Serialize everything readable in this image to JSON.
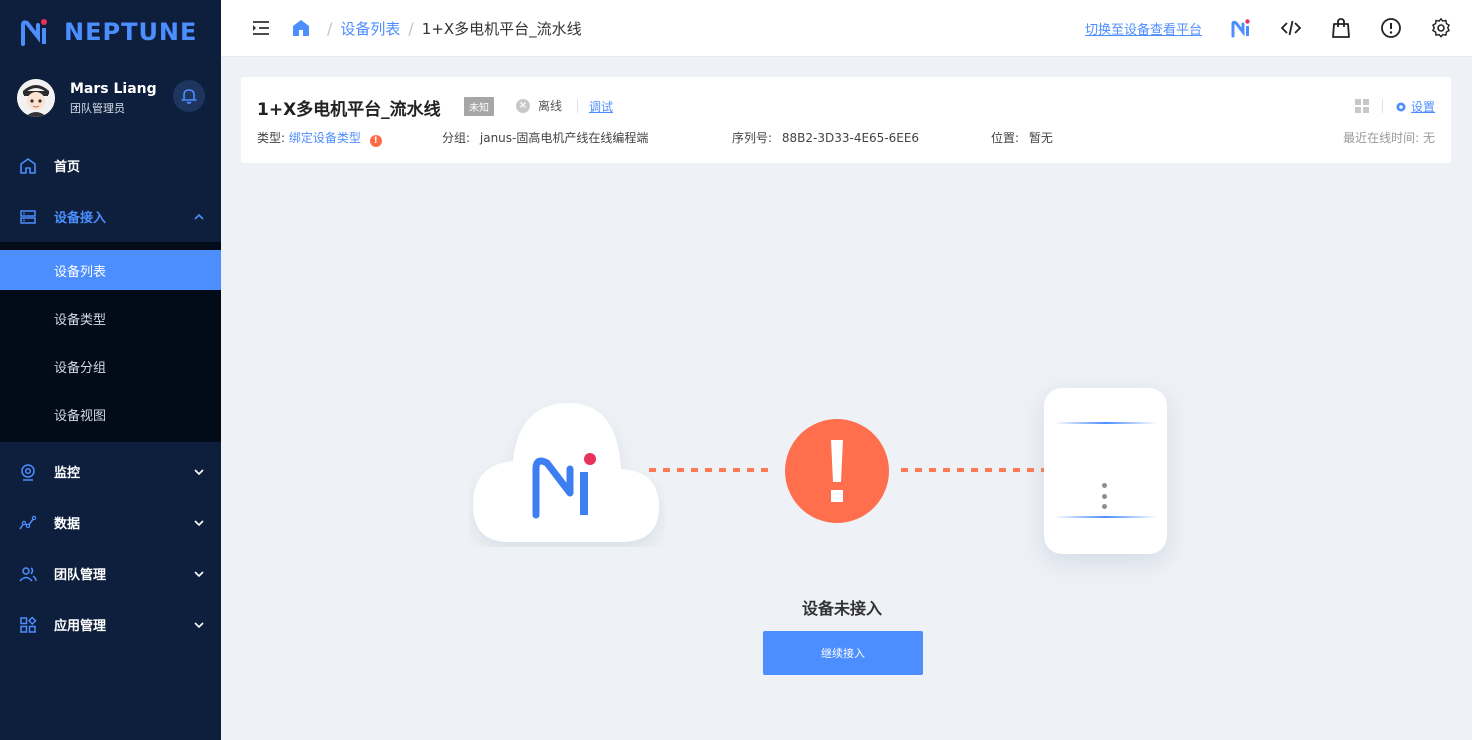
{
  "brand": {
    "name": "NEPTUNE",
    "accent": "#4d8eff"
  },
  "user": {
    "name": "Mars Liang",
    "role": "团队管理员"
  },
  "nav": {
    "home": "首页",
    "device_access": "设备接入",
    "sub": [
      "设备列表",
      "设备类型",
      "设备分组",
      "设备视图"
    ],
    "monitor": "监控",
    "data": "数据",
    "team": "团队管理",
    "apps": "应用管理"
  },
  "topbar": {
    "breadcrumb_list": "设备列表",
    "breadcrumb_current": "1+X多电机平台_流水线",
    "switch_link": "切换至设备查看平台"
  },
  "device": {
    "title": "1+X多电机平台_流水线",
    "badge": "未知",
    "status": "离线",
    "debug": "调试",
    "settings": "设置",
    "type_label": "类型:",
    "type_value": "绑定设备类型",
    "group_label": "分组:",
    "group_value": "janus-固高电机产线在线编程端",
    "serial_label": "序列号:",
    "serial_value": "88B2-3D33-4E65-6EE6",
    "location_label": "位置:",
    "location_value": "暂无",
    "last_online": "最近在线时间: 无"
  },
  "main": {
    "status_title": "设备未接入",
    "continue_button": "继续接入"
  }
}
